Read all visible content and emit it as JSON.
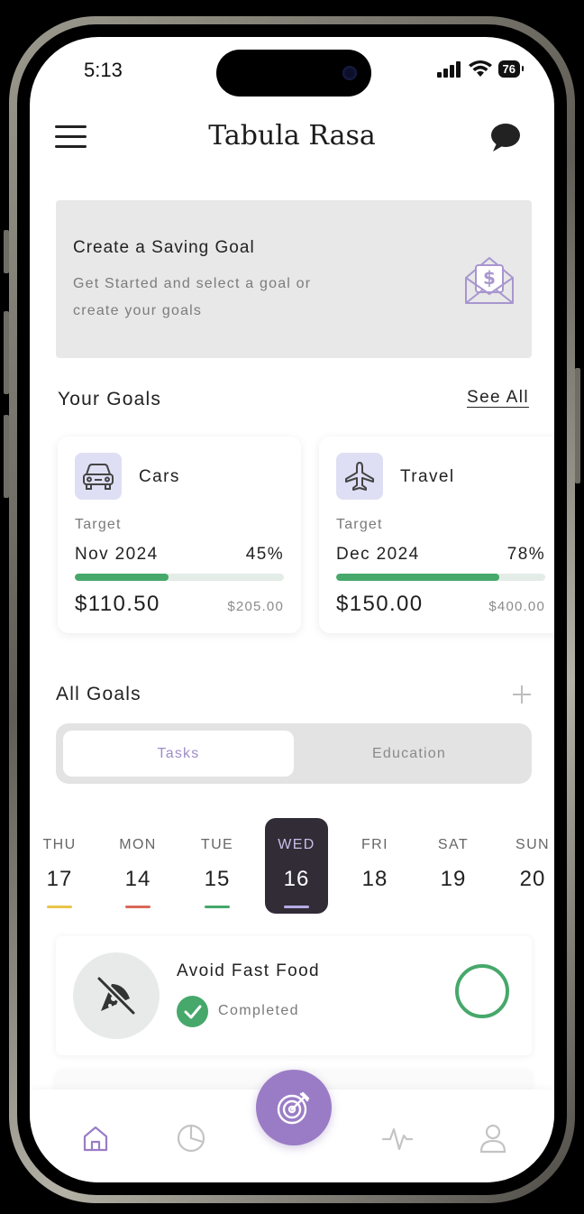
{
  "status_bar": {
    "time": "5:13",
    "battery": "76"
  },
  "header": {
    "title": "Tabula Rasa"
  },
  "create_goal": {
    "title": "Create a Saving Goal",
    "subtitle": "Get Started and select a goal or create your goals"
  },
  "your_goals": {
    "title": "Your Goals",
    "see_all": "See All",
    "cards": [
      {
        "name": "Cars",
        "target_label": "Target",
        "date": "Nov 2024",
        "percent_label": "45%",
        "progress": 0.45,
        "saved": "$110.50",
        "total": "$205.00",
        "icon": "car-icon"
      },
      {
        "name": "Travel",
        "target_label": "Target",
        "date": "Dec 2024",
        "percent_label": "78%",
        "progress": 0.78,
        "saved": "$150.00",
        "total": "$400.00",
        "icon": "airplane-icon"
      }
    ]
  },
  "all_goals": {
    "title": "All Goals",
    "tabs": [
      {
        "label": "Tasks",
        "active": true
      },
      {
        "label": "Education",
        "active": false
      }
    ]
  },
  "days": [
    {
      "label": "THU",
      "num": "17",
      "mark_color": "#e8c547"
    },
    {
      "label": "MON",
      "num": "14",
      "mark_color": "#d9695a"
    },
    {
      "label": "TUE",
      "num": "15",
      "mark_color": "#46a86a"
    },
    {
      "label": "WED",
      "num": "16",
      "mark_color": "#b6abe6",
      "active": true
    },
    {
      "label": "FRI",
      "num": "18"
    },
    {
      "label": "SAT",
      "num": "19"
    },
    {
      "label": "SUN",
      "num": "20"
    }
  ],
  "task": {
    "title": "Avoid Fast Food",
    "status": "Completed",
    "icon": "no-pizza-icon"
  },
  "colors": {
    "accent": "#9a7cc6",
    "success": "#46a86a",
    "dark": "#322c37"
  },
  "nav": [
    "home-icon",
    "pie-chart-icon",
    "target-icon",
    "activity-icon",
    "profile-icon"
  ]
}
